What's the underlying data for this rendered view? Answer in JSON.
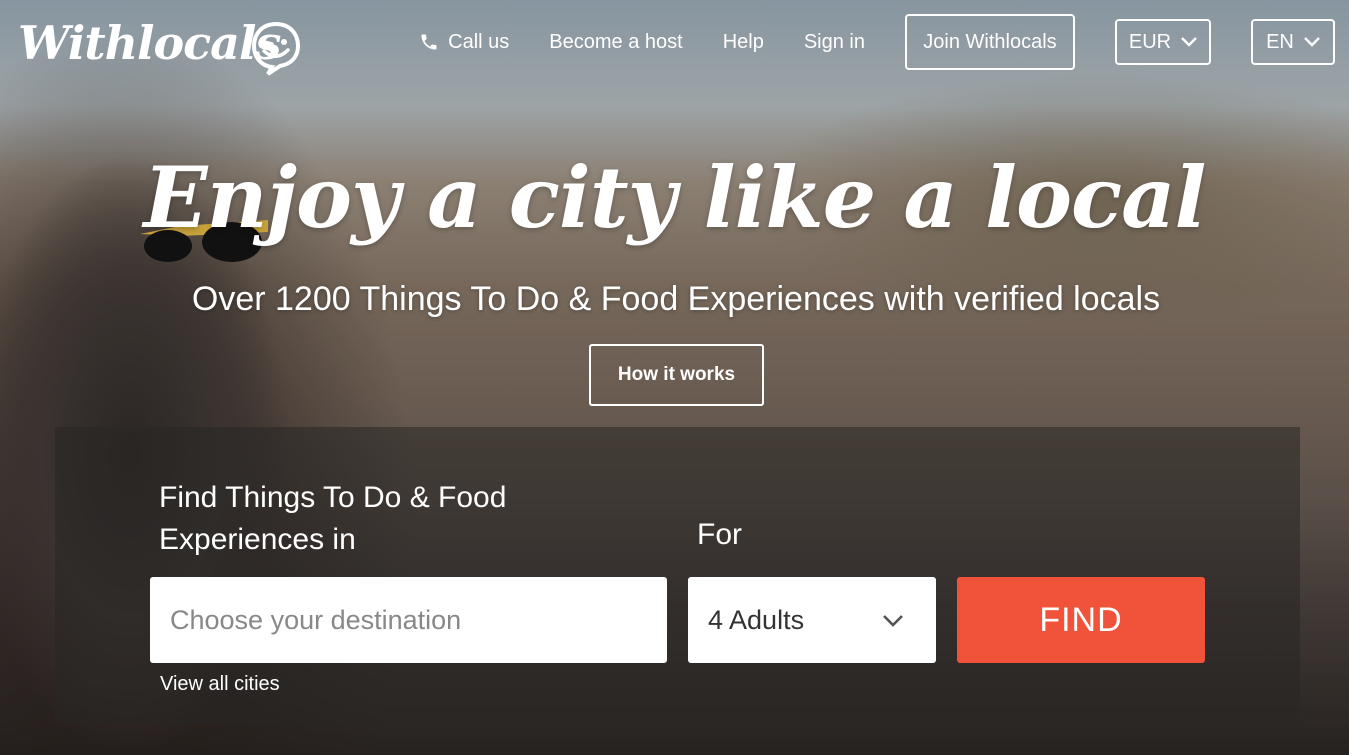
{
  "header": {
    "logo_text": "Withlocals",
    "nav": {
      "call_us": "Call us",
      "become_host": "Become a host",
      "help": "Help",
      "sign_in": "Sign in",
      "join": "Join Withlocals",
      "currency": "EUR",
      "language": "EN"
    }
  },
  "hero": {
    "headline": "Enjoy a city like a local",
    "subheadline": "Over 1200 Things To Do & Food Experiences with verified locals",
    "how_it_works": "How it works"
  },
  "search": {
    "find_label": "Find Things To Do & Food Experiences in",
    "for_label": "For",
    "destination_placeholder": "Choose your destination",
    "guests_value": "4 Adults",
    "find_button": "FIND",
    "view_all": "View all cities"
  },
  "colors": {
    "accent": "#f0533a",
    "text": "#ffffff"
  },
  "icons": {
    "phone": "phone-icon",
    "chevron": "chevron-down-icon",
    "logo_smile": "smile-icon"
  }
}
